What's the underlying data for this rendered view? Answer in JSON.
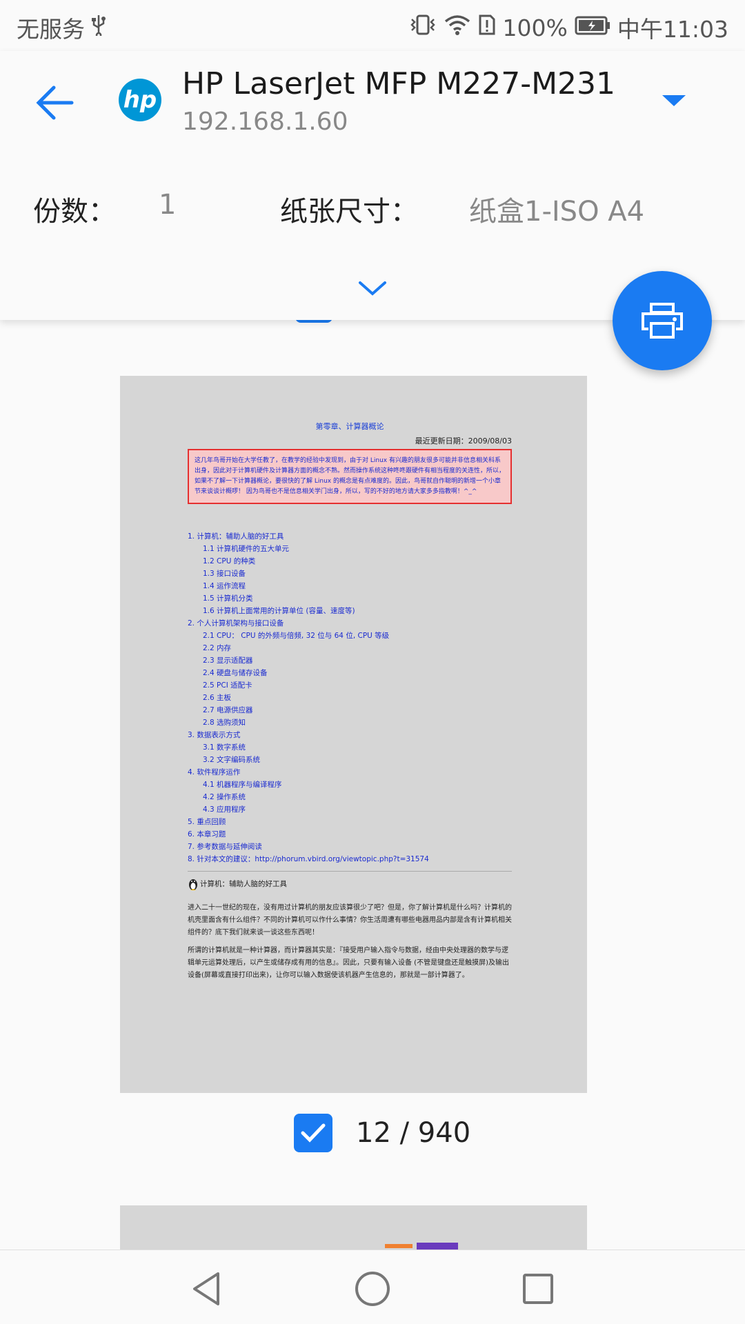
{
  "status_bar": {
    "carrier": "无服务",
    "battery": "100%",
    "time": "中午11:03"
  },
  "printer": {
    "name": "HP LaserJet MFP M227-M231",
    "ip": "192.168.1.60"
  },
  "settings": {
    "copies_label": "份数：",
    "copies_value": "1",
    "paper_label": "纸张尺寸：",
    "paper_value": "纸盒1-ISO A4"
  },
  "preview": {
    "page_counter": "12 / 940",
    "doc": {
      "title": "第零章、计算器概论",
      "updated": "最近更新日期：2009/08/03",
      "notice": "这几年鸟哥开始在大学任教了，在教学的经验中发现到，由于对 Linux 有兴趣的朋友很多可能并非信息相关科系出身，因此对于计算机硬件及计算器方面的概念不熟。然而操作系统这种咚咚跟硬件有相当程度的关连性，所以，如果不了解一下计算器概论，要很快的了解 Linux 的概念是有点难度的。因此，鸟哥就自作聪明的新增一个小章节来谈谈计概啰！ 因为鸟哥也不是信息相关学门出身，所以，写的不好的地方请大家多多指教啊！^_^",
      "toc": [
        {
          "text": "1. 计算机：辅助人脑的好工具",
          "sub": false
        },
        {
          "text": "1.1 计算机硬件的五大单元",
          "sub": true
        },
        {
          "text": "1.2 CPU 的种类",
          "sub": true
        },
        {
          "text": "1.3 接口设备",
          "sub": true
        },
        {
          "text": "1.4 运作流程",
          "sub": true
        },
        {
          "text": "1.5 计算机分类",
          "sub": true
        },
        {
          "text": "1.6 计算机上面常用的计算单位 (容量、速度等)",
          "sub": true
        },
        {
          "text": "2. 个人计算机架构与接口设备",
          "sub": false
        },
        {
          "text": "2.1 CPU： CPU 的外频与倍频, 32 位与 64 位, CPU 等级",
          "sub": true
        },
        {
          "text": "2.2 内存",
          "sub": true
        },
        {
          "text": "2.3 显示适配器",
          "sub": true
        },
        {
          "text": "2.4 硬盘与储存设备",
          "sub": true
        },
        {
          "text": "2.5 PCI 适配卡",
          "sub": true
        },
        {
          "text": "2.6 主板",
          "sub": true
        },
        {
          "text": "2.7 电源供应器",
          "sub": true
        },
        {
          "text": "2.8 选购须知",
          "sub": true
        },
        {
          "text": "3. 数据表示方式",
          "sub": false
        },
        {
          "text": "3.1 数字系统",
          "sub": true
        },
        {
          "text": "3.2 文字编码系统",
          "sub": true
        },
        {
          "text": "4. 软件程序运作",
          "sub": false
        },
        {
          "text": "4.1 机器程序与编译程序",
          "sub": true
        },
        {
          "text": "4.2 操作系统",
          "sub": true
        },
        {
          "text": "4.3 应用程序",
          "sub": true
        },
        {
          "text": "5. 重点回顾",
          "sub": false
        },
        {
          "text": "6. 本章习题",
          "sub": false
        },
        {
          "text": "7. 参考数据与延伸阅读",
          "sub": false
        },
        {
          "text": "8. 针对本文的建议：http://phorum.vbird.org/viewtopic.php?t=31574",
          "sub": false
        }
      ],
      "section_title": "计算机：辅助人脑的好工具",
      "para1": "进入二十一世纪的现在，没有用过计算机的朋友应该算很少了吧？但是，你了解计算机是什么吗？计算机的机壳里面含有什么组件？不同的计算机可以作什么事情？你生活周遭有哪些电器用品内部是含有计算机相关组件的？底下我们就来谈一谈这些东西呢！",
      "para2": "所谓的计算机就是一种计算器，而计算器其实是：『接受用户输入指令与数据，经由中央处理器的数学与逻辑单元运算处理后，以产生或储存成有用的信息』。因此，只要有输入设备 (不管是键盘还是触摸屏)及输出设备(屏幕或直接打印出来)，让你可以输入数据使该机器产生信息的，那就是一部计算器了。"
    }
  }
}
